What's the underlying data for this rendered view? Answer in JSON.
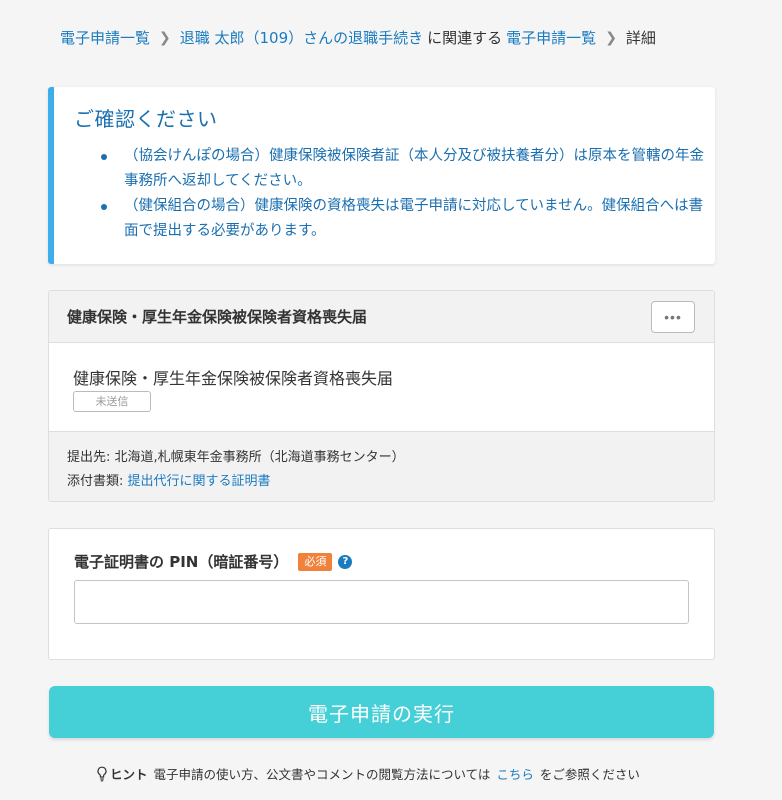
{
  "breadcrumb": {
    "item1": "電子申請一覧",
    "item2": "退職 太郎（109）さんの退職手続き",
    "connector": "に関連する",
    "item3": "電子申請一覧",
    "current": "詳細"
  },
  "notice": {
    "title": "ご確認ください",
    "items": [
      "（協会けんぽの場合）健康保険被保険者証（本人分及び被扶養者分）は原本を管轄の年金事務所へ返却してください。",
      "（健保組合の場合）健康保険の資格喪失は電子申請に対応していません。健保組合へは書面で提出する必要があります。"
    ]
  },
  "form_card": {
    "header_title": "健康保険・厚生年金保険被保険者資格喪失届",
    "more_label": "•••",
    "form_name": "健康保険・厚生年金保険被保険者資格喪失届",
    "status": "未送信",
    "submit_to_label": "提出先:",
    "submit_to_value": "北海道,札幌東年金事務所（北海道事務センター）",
    "attachments_label": "添付書類:",
    "attachments_link": "提出代行に関する証明書"
  },
  "pin": {
    "label": "電子証明書の PIN（暗証番号）",
    "required": "必須",
    "help": "?",
    "value": "",
    "placeholder": ""
  },
  "submit": {
    "label": "電子申請の実行"
  },
  "hint": {
    "label": "ヒント",
    "text_before": "電子申請の使い方、公文書やコメントの閲覧方法については",
    "link": "こちら",
    "text_after": "をご参照ください"
  },
  "colors": {
    "link": "#1a7bbf",
    "notice_accent": "#3daee9",
    "submit_bg": "#45cfd6",
    "required_badge": "#f0823c"
  }
}
